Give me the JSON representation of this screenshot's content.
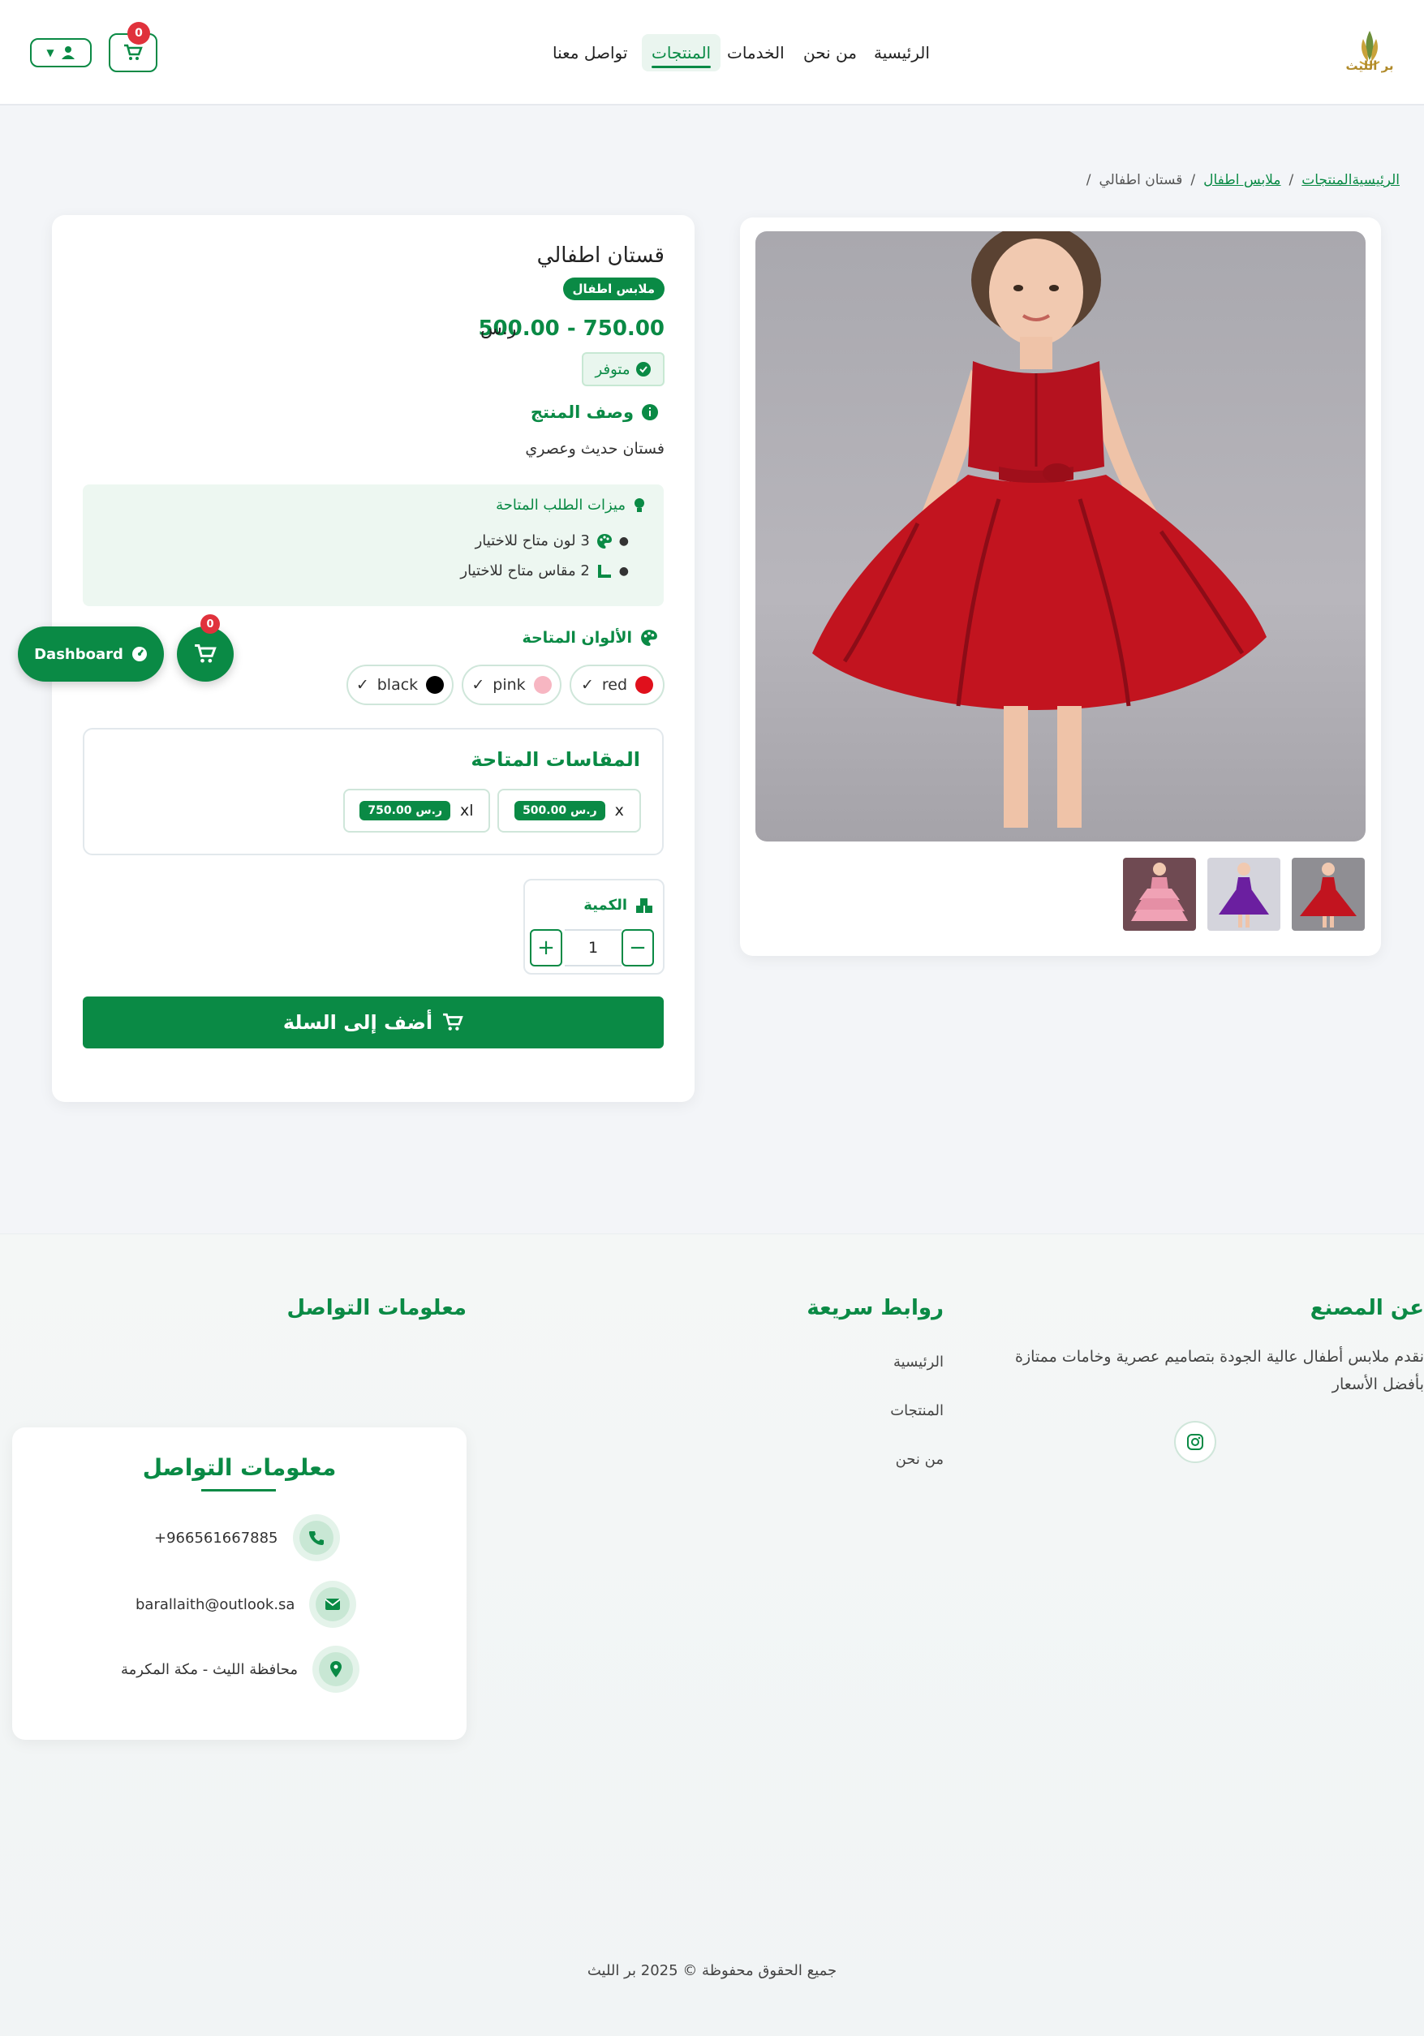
{
  "header": {
    "nav": [
      "الرئيسية",
      "من نحن",
      "الخدمات",
      "المنتجات",
      "تواصل معنا"
    ],
    "active_nav": "المنتجات",
    "cart_count": "0",
    "logo_text": "بر الليث"
  },
  "breadcrumb": [
    "الرئيسية",
    "المنتجات",
    "ملابس اطفال",
    "قستان اطفالي"
  ],
  "product": {
    "title": "قستان اطفالي",
    "category": "ملابس اطفال",
    "price_range": "500.00 - 750.00",
    "currency": "ر.س",
    "stock_status": "متوفر",
    "description_title": "وصف المنتج",
    "description": "فستان حديث وعصري",
    "features_title": "ميزات الطلب المتاحة",
    "features": [
      "3 لون متاح للاختيار",
      "2 مقاس متاح للاختيار"
    ],
    "colors_title": "الألوان المتاحة",
    "colors": [
      {
        "name": "red",
        "hex": "#e0101c"
      },
      {
        "name": "pink",
        "hex": "#f7b6c2"
      },
      {
        "name": "black",
        "hex": "#000000"
      }
    ],
    "sizes_title": "المقاسات المتاحة",
    "sizes": [
      {
        "name": "x",
        "price": "500.00 ر.س"
      },
      {
        "name": "xl",
        "price": "750.00 ر.س"
      }
    ],
    "quantity_label": "الكمية",
    "quantity": "1",
    "add_to_cart": "أضف إلى السلة"
  },
  "floating": {
    "dashboard_label": "Dashboard",
    "cart_count": "0"
  },
  "footer": {
    "about_title": "عن المصنع",
    "about_text": "نقدم ملابس أطفال عالية الجودة بتصاميم عصرية وخامات ممتازة بأفضل الأسعار",
    "links_title": "روابط سريعة",
    "links": [
      "الرئيسية",
      "المنتجات",
      "من نحن"
    ],
    "contact_title": "معلومات التواصل",
    "contact_card_title": "معلومات التواصل",
    "phone": "+966561667885",
    "email": "barallaith@outlook.sa",
    "address": "محافظة الليث - مكة المكرمة",
    "copyright": "جميع الحقوق محفوظة © 2025 بر الليث"
  },
  "colors": {
    "primary": "#0a8a45",
    "badge_red": "#e0323c",
    "background": "#f3f5f8"
  }
}
